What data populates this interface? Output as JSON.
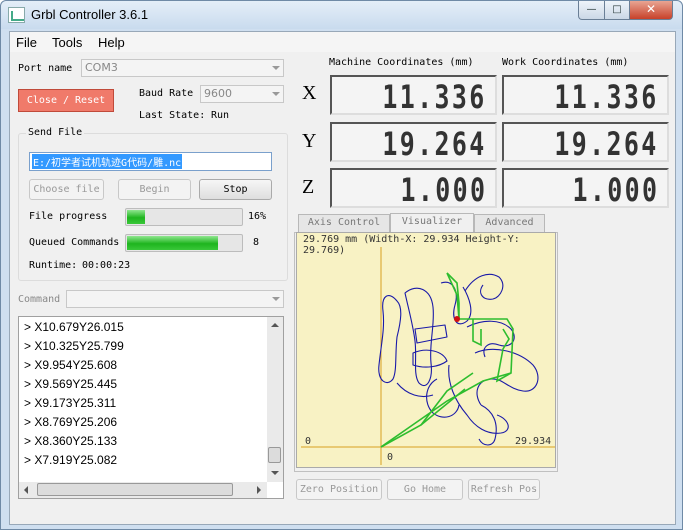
{
  "window": {
    "title": "Grbl Controller 3.6.1",
    "min_glyph": "—",
    "max_glyph": "□",
    "close_glyph": "✕"
  },
  "menu": {
    "file": "File",
    "tools": "Tools",
    "help": "Help"
  },
  "port": {
    "label": "Port name",
    "value": "COM3"
  },
  "baud": {
    "label": "Baud Rate",
    "value": "9600"
  },
  "close_reset": "Close / Reset",
  "state": {
    "label": "Last State:",
    "value": "Run"
  },
  "send_file": {
    "group_title": "Send File",
    "path": "E:/初学者试机轨迹G代码/雕.nc",
    "choose_label": "Choose file",
    "begin_label": "Begin",
    "stop_label": "Stop"
  },
  "progress": {
    "file_label": "File progress",
    "file_value": 0.16,
    "file_text": "16%",
    "queued_label": "Queued Commands",
    "queued_value": 0.8,
    "queued_text": "8",
    "runtime_label": "Runtime:",
    "runtime_value": "00:00:23"
  },
  "command": {
    "label": "Command",
    "value": ""
  },
  "log_lines": [
    "> X10.679Y26.015",
    "> X10.325Y25.799",
    "> X9.954Y25.608",
    "> X9.569Y25.445",
    "> X9.173Y25.311",
    "> X8.769Y25.206",
    "> X8.360Y25.133",
    "> X7.919Y25.082"
  ],
  "coords": {
    "machine_title": "Machine Coordinates (mm)",
    "work_title": "Work Coordinates (mm)",
    "axes": [
      {
        "name": "X",
        "machine": "11.336",
        "work": "11.336"
      },
      {
        "name": "Y",
        "machine": "19.264",
        "work": "19.264"
      },
      {
        "name": "Z",
        "machine": "1.000",
        "work": "1.000"
      }
    ]
  },
  "tabs": {
    "axis_control": "Axis Control",
    "visualizer": "Visualizer",
    "advanced": "Advanced"
  },
  "visualizer": {
    "header": "29.769 mm  (Width-X: 29.934  Height-Y: 29.769)",
    "y_zero": "0",
    "x_zero": "0",
    "x_max": "29.934",
    "colors": {
      "path": "#1a1aa8",
      "progress": "#2ebd2e",
      "tool": "#d01010",
      "axis": "#d8a020"
    }
  },
  "bottom_buttons": {
    "zero_position": "Zero Position",
    "go_home": "Go Home",
    "refresh_pos": "Refresh Pos"
  }
}
